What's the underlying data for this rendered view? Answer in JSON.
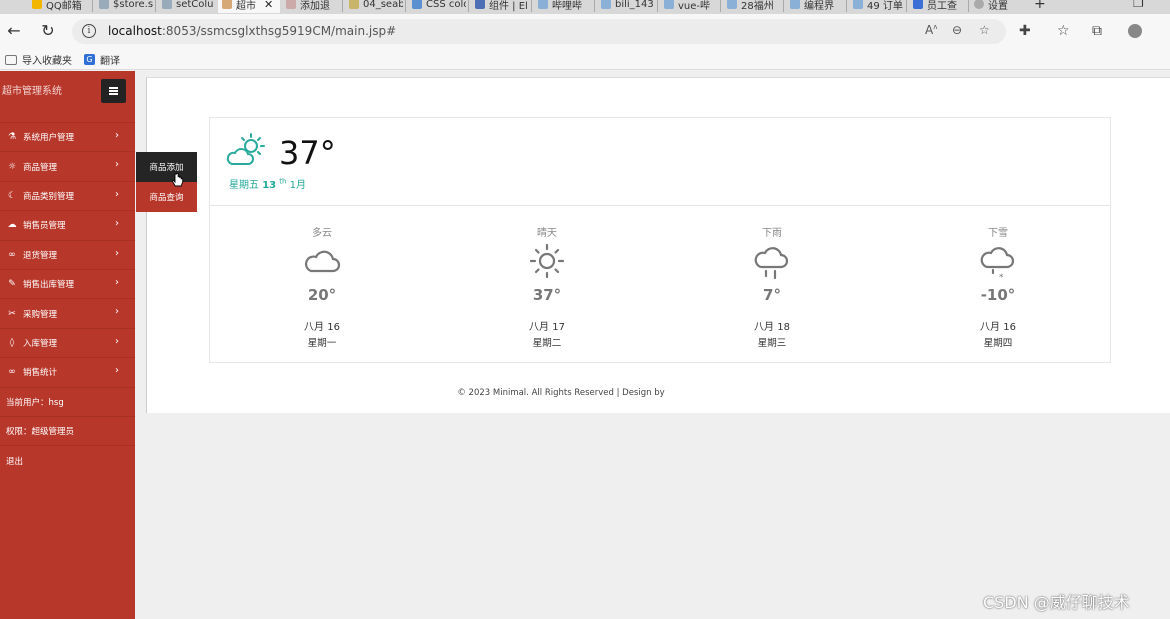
{
  "browser": {
    "tabs": [
      {
        "label": "QQ邮箱"
      },
      {
        "label": "$store.s"
      },
      {
        "label": "setColu"
      },
      {
        "label": "超市",
        "active": true
      },
      {
        "label": "添加退"
      },
      {
        "label": "04_seab"
      },
      {
        "label": "CSS colo"
      },
      {
        "label": "组件 | El"
      },
      {
        "label": "哔哩哔"
      },
      {
        "label": "bili_143"
      },
      {
        "label": "vue-哔"
      },
      {
        "label": "28福州"
      },
      {
        "label": "编程界"
      },
      {
        "label": "49 订单"
      },
      {
        "label": "员工查"
      },
      {
        "label": "设置"
      }
    ],
    "url_host": "localhost",
    "url_rest": ":8053/ssmcsglxthsg5919CM/main.jsp#",
    "bookmarks": [
      {
        "label": "导入收藏夹"
      },
      {
        "label": "翻译"
      }
    ]
  },
  "sidebar": {
    "title": "超市管理系统",
    "items": [
      {
        "label": "系统用户管理",
        "icon": "flask-icon"
      },
      {
        "label": "商品管理",
        "icon": "sun-icon"
      },
      {
        "label": "商品类别管理",
        "icon": "moon-icon"
      },
      {
        "label": "销售员管理",
        "icon": "cloud-icon"
      },
      {
        "label": "退货管理",
        "icon": "link-icon"
      },
      {
        "label": "销售出库管理",
        "icon": "pencil-icon"
      },
      {
        "label": "采购管理",
        "icon": "tools-icon"
      },
      {
        "label": "入库管理",
        "icon": "drop-icon"
      },
      {
        "label": "销售统计",
        "icon": "link-icon"
      }
    ],
    "current_user": "当前用户：hsg",
    "role": "权限：超级管理员",
    "logout": "退出",
    "flyout": [
      "商品添加",
      "商品查询"
    ]
  },
  "weather": {
    "current_temp": "37°",
    "date_weekday": "星期五",
    "date_day": "13",
    "date_suffix": "th",
    "date_month": "1月",
    "forecast": [
      {
        "condition": "多云",
        "temp": "20°",
        "date": "八月 16",
        "weekday": "星期一",
        "icon": "cloud-icon"
      },
      {
        "condition": "晴天",
        "temp": "37°",
        "date": "八月 17",
        "weekday": "星期二",
        "icon": "sun-icon"
      },
      {
        "condition": "下雨",
        "temp": "7°",
        "date": "八月 18",
        "weekday": "星期三",
        "icon": "rain-icon"
      },
      {
        "condition": "下雪",
        "temp": "-10°",
        "date": "八月 16",
        "weekday": "星期四",
        "icon": "snow-icon"
      }
    ]
  },
  "footer": "© 2023 Minimal. All Rights Reserved | Design by",
  "watermark": "CSDN @威仔聊技术",
  "colors": {
    "sidebar": "#b8372b",
    "accent": "#21a89a",
    "flyout_hover": "#252525"
  }
}
